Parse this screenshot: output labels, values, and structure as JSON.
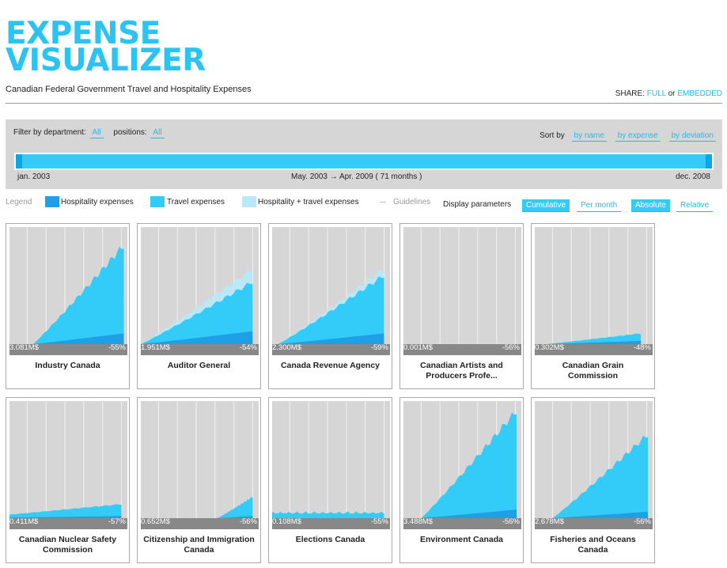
{
  "header": {
    "title_line1": "EXPENSE",
    "title_line2": "VISUALIZER",
    "subtitle": "Canadian Federal Government Travel and Hospitality Expenses",
    "share_label": "SHARE:",
    "share_full": "FULL",
    "share_or": "or",
    "share_embedded": "EMBEDDED"
  },
  "filters": {
    "department_label": "Filter by department:",
    "department_value": "All",
    "positions_label": "positions:",
    "positions_value": "All",
    "sort_label": "Sort by",
    "sort_options": [
      "by name",
      "by expense",
      "by deviation"
    ]
  },
  "timeline": {
    "start_label": "jan. 2003",
    "range_label": "May. 2003 → Apr. 2009 ( 71 months )",
    "end_label": "dec. 2008"
  },
  "legend": {
    "title": "Legend",
    "items": [
      "Hospitality expenses",
      "Travel expenses",
      "Hospitality + travel expenses",
      "Guidelines"
    ],
    "colors": {
      "hospitality": "#1f9fe6",
      "travel": "#33ccf8",
      "combined": "#b9e9f9",
      "guidelines": "#cccccc",
      "panel": "#d6d6d6",
      "footer": "#888888"
    }
  },
  "display": {
    "label": "Display parameters",
    "cumulative": "Cumulative",
    "per_month": "Per month",
    "absolute": "Absolute",
    "relative": "Relative"
  },
  "departments": [
    {
      "name": "Industry Canada",
      "total": "3.081M$",
      "deviation": "-55%",
      "travel_level": 0.92,
      "combined_level": 0.92,
      "hosp_level": 0.1,
      "start": 0.2,
      "end": 0.97,
      "shape": "smooth"
    },
    {
      "name": "Auditor General",
      "total": "1.951M$",
      "deviation": "-54%",
      "travel_level": 0.58,
      "combined_level": 0.7,
      "hosp_level": 0.12,
      "start": 0.0,
      "end": 0.95,
      "shape": "smooth"
    },
    {
      "name": "Canada Revenue Agency",
      "total": "2.300M$",
      "deviation": "-59%",
      "travel_level": 0.64,
      "combined_level": 0.7,
      "hosp_level": 0.1,
      "start": 0.05,
      "end": 0.95,
      "shape": "smooth"
    },
    {
      "name": "Canadian Artists and Producers Profe...",
      "total": "0.001M$",
      "deviation": "-56%",
      "travel_level": 0.0,
      "combined_level": 0.0,
      "hosp_level": 0.0,
      "start": 0.0,
      "end": 0.95,
      "shape": "smooth"
    },
    {
      "name": "Canadian Grain Commission",
      "total": "0.302M$",
      "deviation": "-48%",
      "travel_level": 0.1,
      "combined_level": 0.1,
      "hosp_level": 0.03,
      "start": 0.1,
      "end": 0.9,
      "shape": "smooth"
    },
    {
      "name": "Canadian Nuclear Safety Commission",
      "total": "0.411M$",
      "deviation": "-57%",
      "travel_level": 0.13,
      "combined_level": 0.13,
      "hosp_level": 0.02,
      "start": 0.0,
      "end": 0.95,
      "shape": "steps"
    },
    {
      "name": "Citizenship and Immigration Canada",
      "total": "0.652M$",
      "deviation": "-56%",
      "travel_level": 0.2,
      "combined_level": 0.2,
      "hosp_level": 0.02,
      "start": 0.65,
      "end": 0.95,
      "shape": "smooth"
    },
    {
      "name": "Elections Canada",
      "total": "0.108M$",
      "deviation": "-55%",
      "travel_level": 0.06,
      "combined_level": 0.06,
      "hosp_level": 0.0,
      "start": 0.0,
      "end": 0.95,
      "shape": "spiky"
    },
    {
      "name": "Environment Canada",
      "total": "3.488M$",
      "deviation": "-56%",
      "travel_level": 1.0,
      "combined_level": 1.0,
      "hosp_level": 0.08,
      "start": 0.15,
      "end": 0.96,
      "shape": "smooth"
    },
    {
      "name": "Fisheries and Oceans Canada",
      "total": "2.678M$",
      "deviation": "-56%",
      "travel_level": 0.78,
      "combined_level": 0.78,
      "hosp_level": 0.06,
      "start": 0.15,
      "end": 0.96,
      "shape": "smooth"
    }
  ]
}
